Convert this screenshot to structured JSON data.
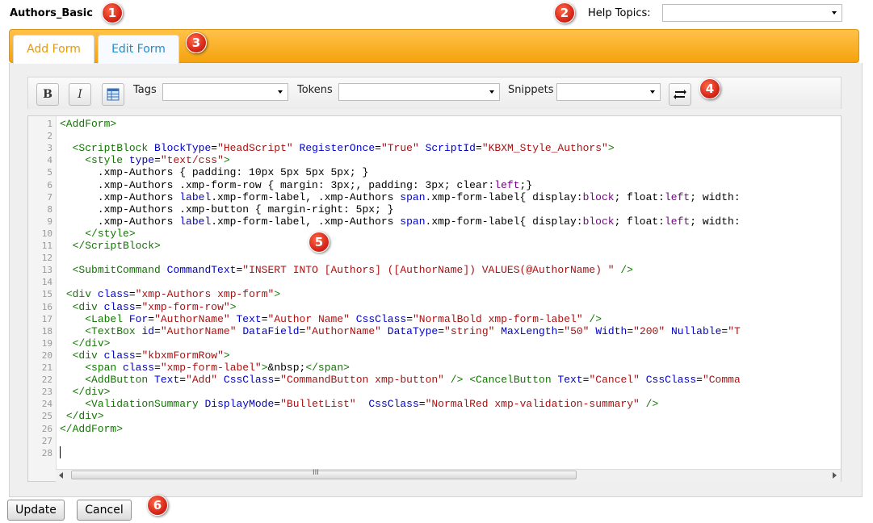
{
  "page_title": "Authors_Basic",
  "help": {
    "label": "Help Topics:",
    "selected": ""
  },
  "callouts": [
    "1",
    "2",
    "3",
    "4",
    "5",
    "6"
  ],
  "tabs": [
    {
      "label": "Add Form",
      "active": true
    },
    {
      "label": "Edit Form",
      "active": false
    }
  ],
  "toolbar": {
    "bold": "B",
    "italic": "I",
    "tags_label": "Tags",
    "tokens_label": "Tokens",
    "snippets_label": "Snippets",
    "tags_value": "",
    "tokens_value": "",
    "snippets_value": ""
  },
  "scroll_icon": "III",
  "colors": {
    "accent_orange": "#f5a20e",
    "tab_add": "#e79a07",
    "tab_edit": "#1c8ec9",
    "callout_red": "#d8281a"
  },
  "code_lines": [
    [
      [
        "t",
        "<AddForm>"
      ]
    ],
    [],
    [
      [
        "p",
        "  "
      ],
      [
        "t",
        "<ScriptBlock"
      ],
      [
        "p",
        " "
      ],
      [
        "a",
        "BlockType"
      ],
      [
        "p",
        "="
      ],
      [
        "s",
        "\"HeadScript\""
      ],
      [
        "p",
        " "
      ],
      [
        "a",
        "RegisterOnce"
      ],
      [
        "p",
        "="
      ],
      [
        "s",
        "\"True\""
      ],
      [
        "p",
        " "
      ],
      [
        "a",
        "ScriptId"
      ],
      [
        "p",
        "="
      ],
      [
        "s",
        "\"KBXM_Style_Authors\""
      ],
      [
        "t",
        ">"
      ]
    ],
    [
      [
        "p",
        "    "
      ],
      [
        "t",
        "<style"
      ],
      [
        "p",
        " "
      ],
      [
        "a",
        "type"
      ],
      [
        "p",
        "="
      ],
      [
        "s",
        "\"text/css\""
      ],
      [
        "t",
        ">"
      ]
    ],
    [
      [
        "p",
        "      .xmp-Authors { padding: 10px 5px 5px 5px; }"
      ]
    ],
    [
      [
        "p",
        "      .xmp-Authors .xmp-form-row { margin: 3px;, padding: 3px; clear:"
      ],
      [
        "k",
        "left"
      ],
      [
        "p",
        ";}"
      ]
    ],
    [
      [
        "p",
        "      .xmp-Authors "
      ],
      [
        "a",
        "label"
      ],
      [
        "p",
        ".xmp-form-label, .xmp-Authors "
      ],
      [
        "a",
        "span"
      ],
      [
        "p",
        ".xmp-form-label{ display:"
      ],
      [
        "k",
        "block"
      ],
      [
        "p",
        "; float:"
      ],
      [
        "k",
        "left"
      ],
      [
        "p",
        "; width:"
      ]
    ],
    [
      [
        "p",
        "      .xmp-Authors .xmp-button { margin-right: 5px; }"
      ]
    ],
    [
      [
        "p",
        "      .xmp-Authors "
      ],
      [
        "a",
        "label"
      ],
      [
        "p",
        ".xmp-form-label, .xmp-Authors "
      ],
      [
        "a",
        "span"
      ],
      [
        "p",
        ".xmp-form-label{ display:"
      ],
      [
        "k",
        "block"
      ],
      [
        "p",
        "; float:"
      ],
      [
        "k",
        "left"
      ],
      [
        "p",
        "; width:"
      ]
    ],
    [
      [
        "p",
        "    "
      ],
      [
        "t",
        "</style>"
      ]
    ],
    [
      [
        "p",
        "  "
      ],
      [
        "t",
        "</ScriptBlock>"
      ]
    ],
    [],
    [
      [
        "p",
        "  "
      ],
      [
        "t",
        "<SubmitCommand"
      ],
      [
        "p",
        " "
      ],
      [
        "a",
        "CommandText"
      ],
      [
        "p",
        "="
      ],
      [
        "s",
        "\"INSERT INTO [Authors] ([AuthorName]) VALUES(@AuthorName) \""
      ],
      [
        "p",
        " "
      ],
      [
        "t",
        "/>"
      ]
    ],
    [],
    [
      [
        "p",
        " "
      ],
      [
        "t",
        "<div"
      ],
      [
        "p",
        " "
      ],
      [
        "a",
        "class"
      ],
      [
        "p",
        "="
      ],
      [
        "s",
        "\"xmp-Authors xmp-form\""
      ],
      [
        "t",
        ">"
      ]
    ],
    [
      [
        "p",
        "  "
      ],
      [
        "t",
        "<div"
      ],
      [
        "p",
        " "
      ],
      [
        "a",
        "class"
      ],
      [
        "p",
        "="
      ],
      [
        "s",
        "\"xmp-form-row\""
      ],
      [
        "t",
        ">"
      ]
    ],
    [
      [
        "p",
        "    "
      ],
      [
        "t",
        "<Label"
      ],
      [
        "p",
        " "
      ],
      [
        "a",
        "For"
      ],
      [
        "p",
        "="
      ],
      [
        "s",
        "\"AuthorName\""
      ],
      [
        "p",
        " "
      ],
      [
        "a",
        "Text"
      ],
      [
        "p",
        "="
      ],
      [
        "s",
        "\"Author Name\""
      ],
      [
        "p",
        " "
      ],
      [
        "a",
        "CssClass"
      ],
      [
        "p",
        "="
      ],
      [
        "s",
        "\"NormalBold xmp-form-label\""
      ],
      [
        "p",
        " "
      ],
      [
        "t",
        "/>"
      ]
    ],
    [
      [
        "p",
        "    "
      ],
      [
        "t",
        "<TextBox"
      ],
      [
        "p",
        " "
      ],
      [
        "a",
        "id"
      ],
      [
        "p",
        "="
      ],
      [
        "s",
        "\"AuthorName\""
      ],
      [
        "p",
        " "
      ],
      [
        "a",
        "DataField"
      ],
      [
        "p",
        "="
      ],
      [
        "s",
        "\"AuthorName\""
      ],
      [
        "p",
        " "
      ],
      [
        "a",
        "DataType"
      ],
      [
        "p",
        "="
      ],
      [
        "s",
        "\"string\""
      ],
      [
        "p",
        " "
      ],
      [
        "a",
        "MaxLength"
      ],
      [
        "p",
        "="
      ],
      [
        "s",
        "\"50\""
      ],
      [
        "p",
        " "
      ],
      [
        "a",
        "Width"
      ],
      [
        "p",
        "="
      ],
      [
        "s",
        "\"200\""
      ],
      [
        "p",
        " "
      ],
      [
        "a",
        "Nullable"
      ],
      [
        "p",
        "="
      ],
      [
        "s",
        "\"T"
      ]
    ],
    [
      [
        "p",
        "  "
      ],
      [
        "t",
        "</div>"
      ]
    ],
    [
      [
        "p",
        "  "
      ],
      [
        "t",
        "<div"
      ],
      [
        "p",
        " "
      ],
      [
        "a",
        "class"
      ],
      [
        "p",
        "="
      ],
      [
        "s",
        "\"kbxmFormRow\""
      ],
      [
        "t",
        ">"
      ]
    ],
    [
      [
        "p",
        "    "
      ],
      [
        "t",
        "<span"
      ],
      [
        "p",
        " "
      ],
      [
        "a",
        "class"
      ],
      [
        "p",
        "="
      ],
      [
        "s",
        "\"xmp-form-label\""
      ],
      [
        "t",
        ">"
      ],
      [
        "p",
        "&nbsp;"
      ],
      [
        "t",
        "</span>"
      ]
    ],
    [
      [
        "p",
        "    "
      ],
      [
        "t",
        "<AddButton"
      ],
      [
        "p",
        " "
      ],
      [
        "a",
        "Text"
      ],
      [
        "p",
        "="
      ],
      [
        "s",
        "\"Add\""
      ],
      [
        "p",
        " "
      ],
      [
        "a",
        "CssClass"
      ],
      [
        "p",
        "="
      ],
      [
        "s",
        "\"CommandButton xmp-button\""
      ],
      [
        "p",
        " "
      ],
      [
        "t",
        "/>"
      ],
      [
        "p",
        " "
      ],
      [
        "t",
        "<CancelButton"
      ],
      [
        "p",
        " "
      ],
      [
        "a",
        "Text"
      ],
      [
        "p",
        "="
      ],
      [
        "s",
        "\"Cancel\""
      ],
      [
        "p",
        " "
      ],
      [
        "a",
        "CssClass"
      ],
      [
        "p",
        "="
      ],
      [
        "s",
        "\"Comma"
      ]
    ],
    [
      [
        "p",
        "  "
      ],
      [
        "t",
        "</div>"
      ]
    ],
    [
      [
        "p",
        "    "
      ],
      [
        "t",
        "<ValidationSummary"
      ],
      [
        "p",
        " "
      ],
      [
        "a",
        "DisplayMode"
      ],
      [
        "p",
        "="
      ],
      [
        "s",
        "\"BulletList\""
      ],
      [
        "p",
        "  "
      ],
      [
        "a",
        "CssClass"
      ],
      [
        "p",
        "="
      ],
      [
        "s",
        "\"NormalRed xmp-validation-summary\""
      ],
      [
        "p",
        " "
      ],
      [
        "t",
        "/>"
      ]
    ],
    [
      [
        "p",
        " "
      ],
      [
        "t",
        "</div>"
      ]
    ],
    [
      [
        "t",
        "</AddForm>"
      ]
    ],
    [],
    []
  ],
  "buttons": {
    "update": "Update",
    "cancel": "Cancel"
  }
}
